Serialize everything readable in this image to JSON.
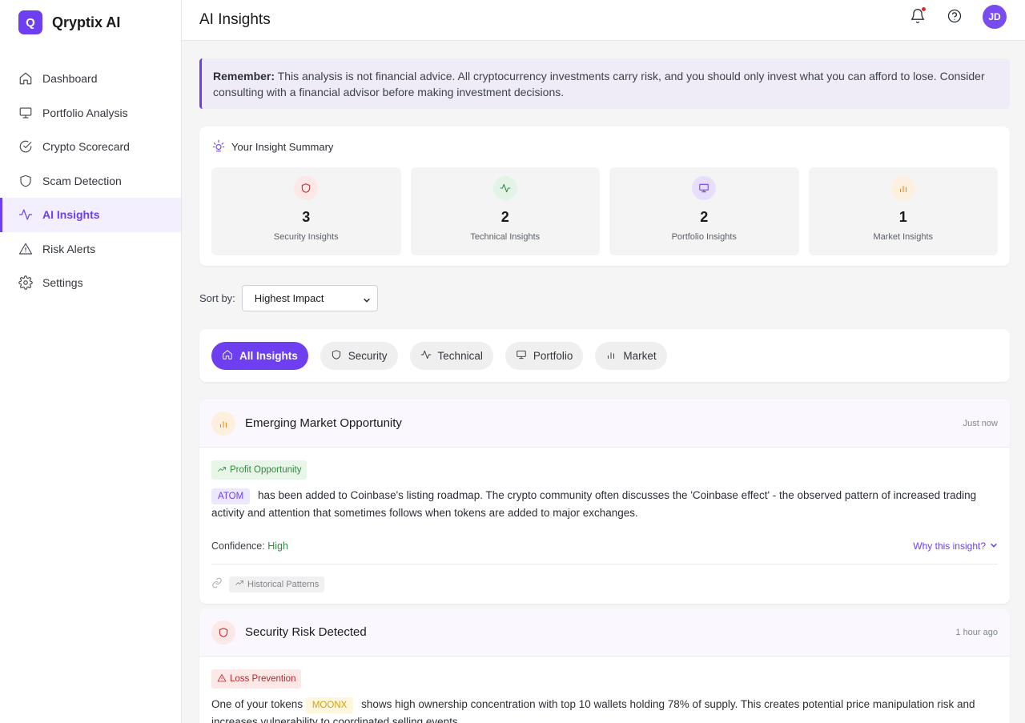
{
  "app": {
    "logo_letter": "Q",
    "name": "Qryptix AI"
  },
  "sidebar": {
    "items": [
      {
        "label": "Dashboard",
        "icon": "home-icon",
        "active": false
      },
      {
        "label": "Portfolio Analysis",
        "icon": "monitor-icon",
        "active": false
      },
      {
        "label": "Crypto Scorecard",
        "icon": "check-circle-icon",
        "active": false
      },
      {
        "label": "Scam Detection",
        "icon": "shield-icon",
        "active": false
      },
      {
        "label": "AI Insights",
        "icon": "activity-icon",
        "active": true
      },
      {
        "label": "Risk Alerts",
        "icon": "warning-triangle-icon",
        "active": false
      },
      {
        "label": "Settings",
        "icon": "gear-icon",
        "active": false
      }
    ]
  },
  "header": {
    "title": "AI Insights",
    "avatar_initials": "JD"
  },
  "disclaimer": {
    "bold": "Remember:",
    "text": " This analysis is not financial advice. All cryptocurrency investments carry risk, and you should only invest what you can afford to lose. Consider consulting with a financial advisor before making investment decisions."
  },
  "summary": {
    "title": "Your Insight Summary",
    "stats": [
      {
        "value": "3",
        "label": "Security Insights",
        "icon": "shield-icon",
        "color": "#c0282e",
        "bg": "#fde8e8"
      },
      {
        "value": "2",
        "label": "Technical Insights",
        "icon": "activity-icon",
        "color": "#2f8a3a",
        "bg": "#e3f4e6"
      },
      {
        "value": "2",
        "label": "Portfolio Insights",
        "icon": "monitor-icon",
        "color": "#6d3ff0",
        "bg": "#e7defc"
      },
      {
        "value": "1",
        "label": "Market Insights",
        "icon": "bar-chart-icon",
        "color": "#e58a1a",
        "bg": "#fdf0de"
      }
    ]
  },
  "sort": {
    "label": "Sort by:",
    "value": "Highest Impact"
  },
  "filters": [
    {
      "label": "All Insights",
      "icon": "home-icon",
      "active": true
    },
    {
      "label": "Security",
      "icon": "shield-icon",
      "active": false
    },
    {
      "label": "Technical",
      "icon": "activity-icon",
      "active": false
    },
    {
      "label": "Portfolio",
      "icon": "monitor-icon",
      "active": false
    },
    {
      "label": "Market",
      "icon": "bar-chart-icon",
      "active": false
    }
  ],
  "insights": [
    {
      "title": "Emerging Market Opportunity",
      "time": "Just now",
      "tag": "Profit Opportunity",
      "token": "ATOM",
      "text": "has been added to Coinbase's listing roadmap. The crypto community often discusses the 'Coinbase effect' - the observed pattern of increased trading activity and attention that sometimes follows when tokens are added to major exchanges.",
      "confidence_label": "Confidence:",
      "confidence_value": "High",
      "why_label": "Why this insight?",
      "source": "Historical Patterns"
    },
    {
      "title": "Security Risk Detected",
      "time": "1 hour ago",
      "tag": "Loss Prevention",
      "text_before": "One of your tokens",
      "token": "MOONX",
      "text": "shows high ownership concentration with top 10 wallets holding 78% of supply. This creates potential price manipulation risk and increases vulnerability to coordinated selling events."
    }
  ]
}
